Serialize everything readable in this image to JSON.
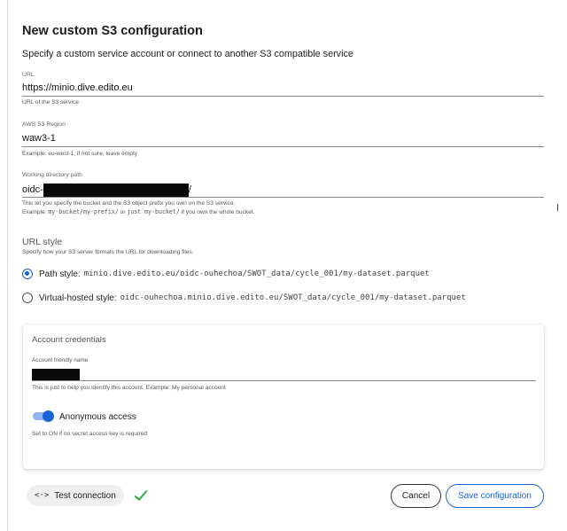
{
  "dialog": {
    "title": "New custom S3 configuration",
    "subtitle": "Specify a custom service account or connect to another S3 compatible service"
  },
  "url_field": {
    "label": "URL",
    "value": "https://minio.dive.edito.eu",
    "helper": "URL of the S3 service"
  },
  "region_field": {
    "label": "AWS S3 Region",
    "value": "waw3-1",
    "helper": "Example: eu-west-1, if not sure, leave empty"
  },
  "workdir_field": {
    "label": "Working directory path",
    "value_prefix": "oidc-",
    "value_suffix": "/",
    "helper_line1": "This let you specify the bucket and the S3 object prefix you own on the S3 service.",
    "helper_line2_a": "Example: ",
    "helper_line2_code1": "my-bucket/my-prefix/",
    "helper_line2_b": " or ",
    "helper_line2_code2": "just my-bucket/",
    "helper_line2_c": " if you own the whole bucket."
  },
  "url_style": {
    "title": "URL style",
    "subtitle": "Specify how your S3 server formats the URL for downloading files.",
    "options": [
      {
        "label": "Path style:",
        "example": "minio.dive.edito.eu/oidc-ouhechoa/SWOT_data/cycle_001/my-dataset.parquet",
        "selected": true
      },
      {
        "label": "Virtual-hosted style:",
        "example": "oidc-ouhechoa.minio.dive.edito.eu/SWOT_data/cycle_001/my-dataset.parquet",
        "selected": false
      }
    ]
  },
  "credentials": {
    "title": "Account credentials",
    "friendly_name_label": "Account friendly name",
    "friendly_name_helper": "This is just to help you identify this account. Example: My personal account",
    "anonymous_label": "Anonymous access",
    "anonymous_on": true,
    "anonymous_helper": "Set to ON if no secret access key is required"
  },
  "footer": {
    "test_icon": "<·>",
    "test_label": "Test connection",
    "test_status_icon": "check-icon",
    "cancel_label": "Cancel",
    "save_label": "Save configuration"
  },
  "colors": {
    "accent": "#1863d6",
    "success": "#2fae3f"
  }
}
